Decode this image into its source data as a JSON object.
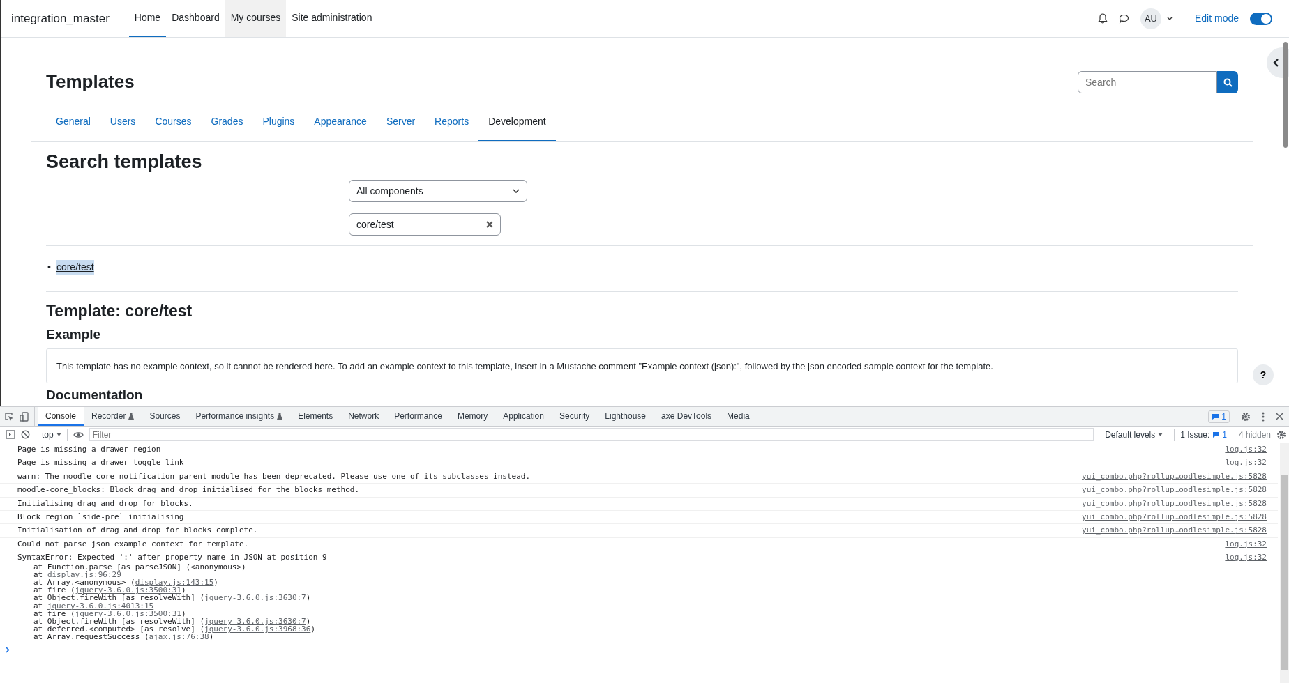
{
  "navbar": {
    "brand": "integration_master",
    "items": [
      {
        "label": "Home",
        "selected": true,
        "highlighted": false
      },
      {
        "label": "Dashboard",
        "selected": false,
        "highlighted": false
      },
      {
        "label": "My courses",
        "selected": false,
        "highlighted": true
      },
      {
        "label": "Site administration",
        "selected": false,
        "highlighted": false
      }
    ],
    "avatar": "AU",
    "edit_mode": {
      "label": "Edit mode",
      "on": true
    }
  },
  "page": {
    "title": "Templates",
    "search": {
      "placeholder": "Search"
    },
    "tabs": [
      {
        "label": "General",
        "selected": false
      },
      {
        "label": "Users",
        "selected": false
      },
      {
        "label": "Courses",
        "selected": false
      },
      {
        "label": "Grades",
        "selected": false
      },
      {
        "label": "Plugins",
        "selected": false
      },
      {
        "label": "Appearance",
        "selected": false
      },
      {
        "label": "Server",
        "selected": false
      },
      {
        "label": "Reports",
        "selected": false
      },
      {
        "label": "Development",
        "selected": true
      }
    ],
    "section_title": "Search templates",
    "component_select": "All components",
    "template_filter": "core/test",
    "results": [
      {
        "marker": "•",
        "label": "core/test",
        "selected": true
      }
    ],
    "template_title": "Template: core/test",
    "example_heading": "Example",
    "example_text": "This template has no example context, so it cannot be rendered here. To add an example context to this template, insert in a Mustache comment \"Example context (json):\", followed by the json encoded sample context for the template.",
    "documentation_heading": "Documentation",
    "help": "?"
  },
  "devtools": {
    "tabs": [
      {
        "label": "Console",
        "selected": true,
        "experimental": false
      },
      {
        "label": "Recorder",
        "selected": false,
        "experimental": true
      },
      {
        "label": "Sources",
        "selected": false,
        "experimental": false
      },
      {
        "label": "Performance insights",
        "selected": false,
        "experimental": true
      },
      {
        "label": "Elements",
        "selected": false,
        "experimental": false
      },
      {
        "label": "Network",
        "selected": false,
        "experimental": false
      },
      {
        "label": "Performance",
        "selected": false,
        "experimental": false
      },
      {
        "label": "Memory",
        "selected": false,
        "experimental": false
      },
      {
        "label": "Application",
        "selected": false,
        "experimental": false
      },
      {
        "label": "Security",
        "selected": false,
        "experimental": false
      },
      {
        "label": "Lighthouse",
        "selected": false,
        "experimental": false
      },
      {
        "label": "axe DevTools",
        "selected": false,
        "experimental": false
      },
      {
        "label": "Media",
        "selected": false,
        "experimental": false
      }
    ],
    "issues_badge": "1",
    "context": "top",
    "filter": {
      "placeholder": "Filter"
    },
    "levels": "Default levels",
    "issues": {
      "label": "1 Issue:",
      "count": "1"
    },
    "hidden": "4 hidden",
    "messages": [
      {
        "text": "Page is missing a drawer region",
        "source": "log.js:32"
      },
      {
        "text": "Page is missing a drawer toggle link",
        "source": "log.js:32"
      },
      {
        "text": "warn: The moodle-core-notification parent module has been deprecated. Please use one of its subclasses instead.",
        "source": "yui_combo.php?rollup…oodlesimple.js:5828"
      },
      {
        "text": "moodle-core_blocks: Block drag and drop initialised for the blocks method.",
        "source": "yui_combo.php?rollup…oodlesimple.js:5828"
      },
      {
        "text": "Initialising drag and drop for blocks.",
        "source": "yui_combo.php?rollup…oodlesimple.js:5828"
      },
      {
        "text": "Block region `side-pre` initialising",
        "source": "yui_combo.php?rollup…oodlesimple.js:5828"
      },
      {
        "text": "Initialisation of drag and drop for blocks complete.",
        "source": "yui_combo.php?rollup…oodlesimple.js:5828"
      },
      {
        "text": "Could not parse json example context for template.",
        "source": "log.js:32"
      },
      {
        "text": "SyntaxError: Expected ':' after property name in JSON at position 9",
        "source": "log.js:32",
        "stack": [
          {
            "before": "at Function.parse [as parseJSON] (<anonymous>)"
          },
          {
            "before": "at ",
            "link": "display.js:96:29"
          },
          {
            "before": "at Array.<anonymous> (",
            "link": "display.js:143:15",
            "after": ")"
          },
          {
            "before": "at fire (",
            "link": "jquery-3.6.0.js:3500:31",
            "after": ")"
          },
          {
            "before": "at Object.fireWith [as resolveWith] (",
            "link": "jquery-3.6.0.js:3630:7",
            "after": ")"
          },
          {
            "before": "at ",
            "link": "jquery-3.6.0.js:4013:15"
          },
          {
            "before": "at fire (",
            "link": "jquery-3.6.0.js:3500:31",
            "after": ")"
          },
          {
            "before": "at Object.fireWith [as resolveWith] (",
            "link": "jquery-3.6.0.js:3630:7",
            "after": ")"
          },
          {
            "before": "at deferred.<computed> [as resolve] (",
            "link": "jquery-3.6.0.js:3968:36",
            "after": ")"
          },
          {
            "before": "at Array.requestSuccess (",
            "link": "ajax.js:76:38",
            "after": ")"
          }
        ]
      }
    ]
  }
}
